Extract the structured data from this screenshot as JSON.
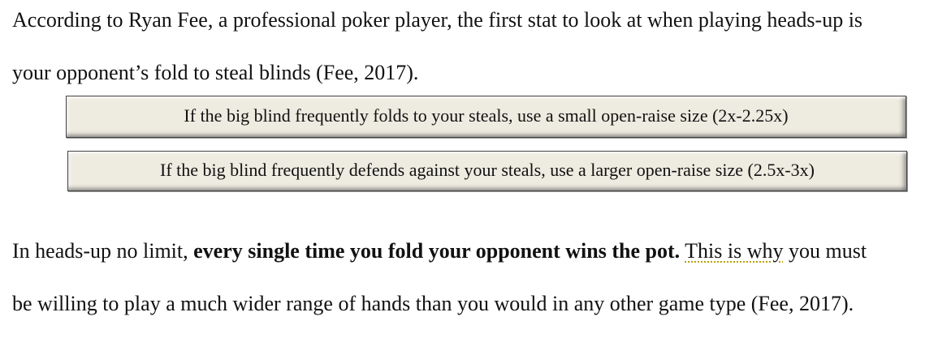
{
  "paragraph1": {
    "line1": "According to Ryan Fee, a professional poker player, the first stat to look at when playing heads-up is",
    "line2": "your opponent’s fold to steal blinds (Fee, 2017)."
  },
  "callouts": [
    {
      "text": "If the big blind frequently folds to your steals, use a small open-raise size (2x-2.25x)"
    },
    {
      "text": "If the big blind frequently defends against your steals, use a larger open-raise size (2.5x-3x)"
    }
  ],
  "paragraph2": {
    "line1_prefix": "In heads-up no limit, ",
    "line1_bold": "every single time you fold your opponent wins the pot.",
    "line1_space": " ",
    "line1_flagged": "This is why",
    "line1_suffix": " you must",
    "line2": "be willing to play a much wider range of hands than you would in any other game type (Fee, 2017)."
  },
  "colors": {
    "callout_background": "#eeebe0",
    "callout_border": "#444444",
    "grammar_flag_underline": "#b8a000"
  }
}
